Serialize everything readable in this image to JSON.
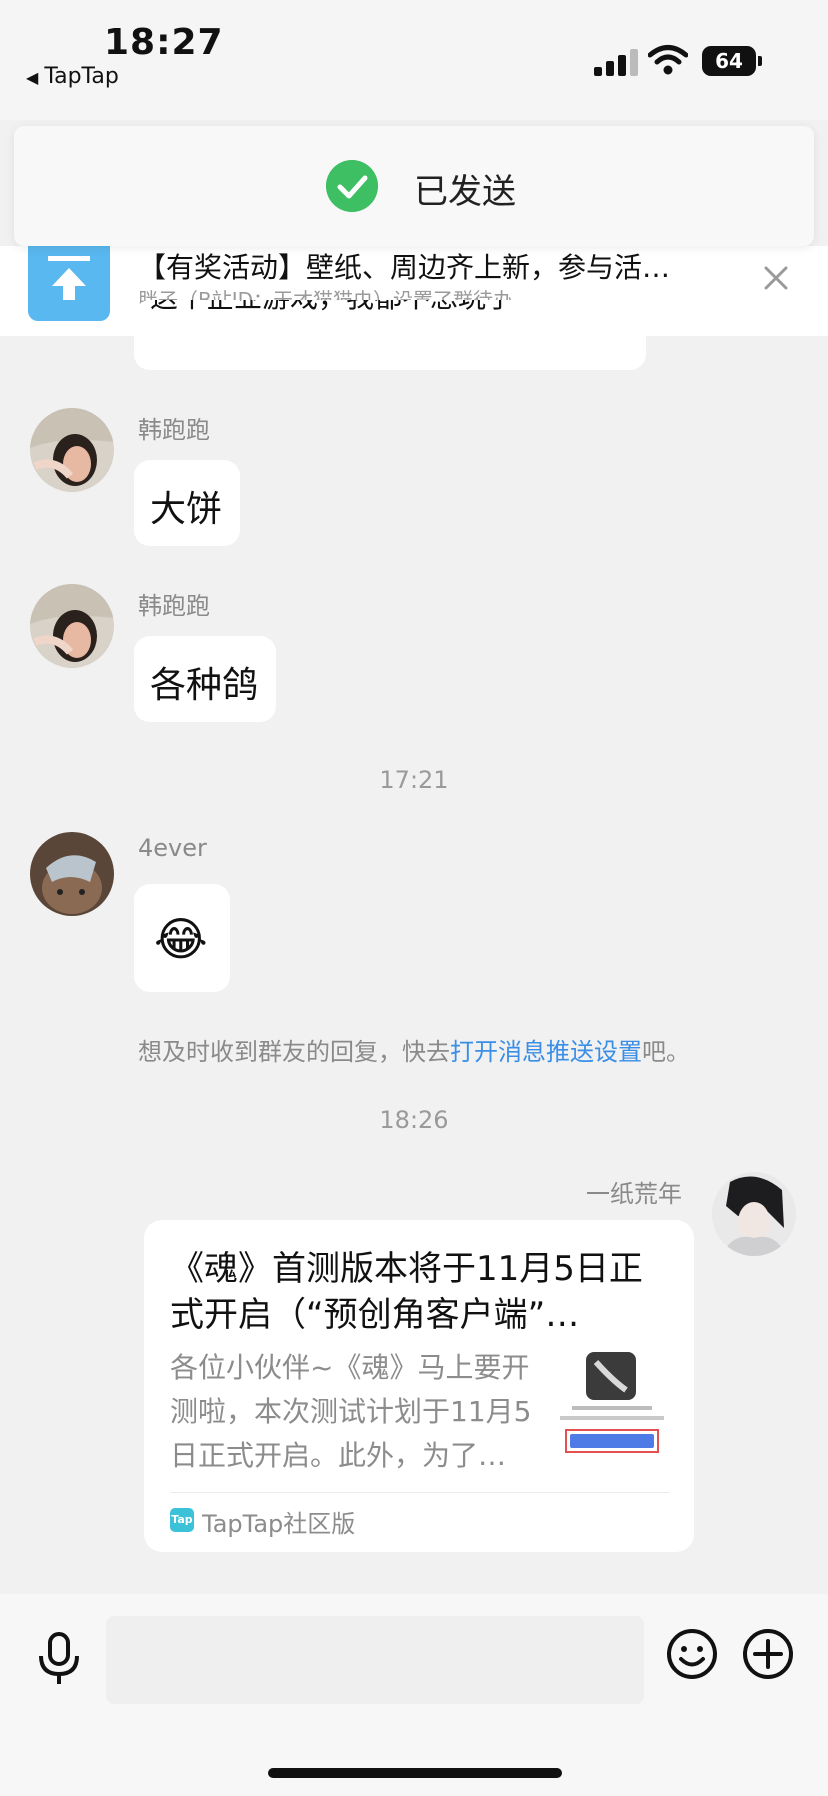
{
  "status_bar": {
    "time": "18:27",
    "back_app": "TapTap",
    "battery": "64"
  },
  "toast": {
    "text": "已发送"
  },
  "pinned": {
    "title": "【有奖活动】壁纸、周边齐上新，参与活…",
    "subtitle": "胖子（B站ID：天才猫猫虫）设置了群待办"
  },
  "messages": {
    "partial_text": "这个企业游戏，我都不想玩了",
    "m1": {
      "sender": "韩跑跑",
      "text": "大饼"
    },
    "m2": {
      "sender": "韩跑跑",
      "text": "各种鸽"
    },
    "ts1": "17:21",
    "m3": {
      "sender": "4ever",
      "text": "😂"
    },
    "notice_prefix": "想及时收到群友的回复，快去",
    "notice_link": "打开消息推送设置",
    "notice_suffix": "吧。",
    "ts2": "18:26",
    "m4": {
      "sender": "一纸荒年"
    }
  },
  "card": {
    "title": "《魂》首测版本将于11月5日正式开启（“预创角客户端”…",
    "description": "各位小伙伴~《魂》马上要开测啦，本次测试计划于11月5日正式开启。此外，为了…",
    "source_icon_text": "Tap",
    "source": "TapTap社区版"
  },
  "colors": {
    "accent": "#3a8ee6",
    "pin_icon": "#59b8ef",
    "success": "#3fbf64"
  }
}
